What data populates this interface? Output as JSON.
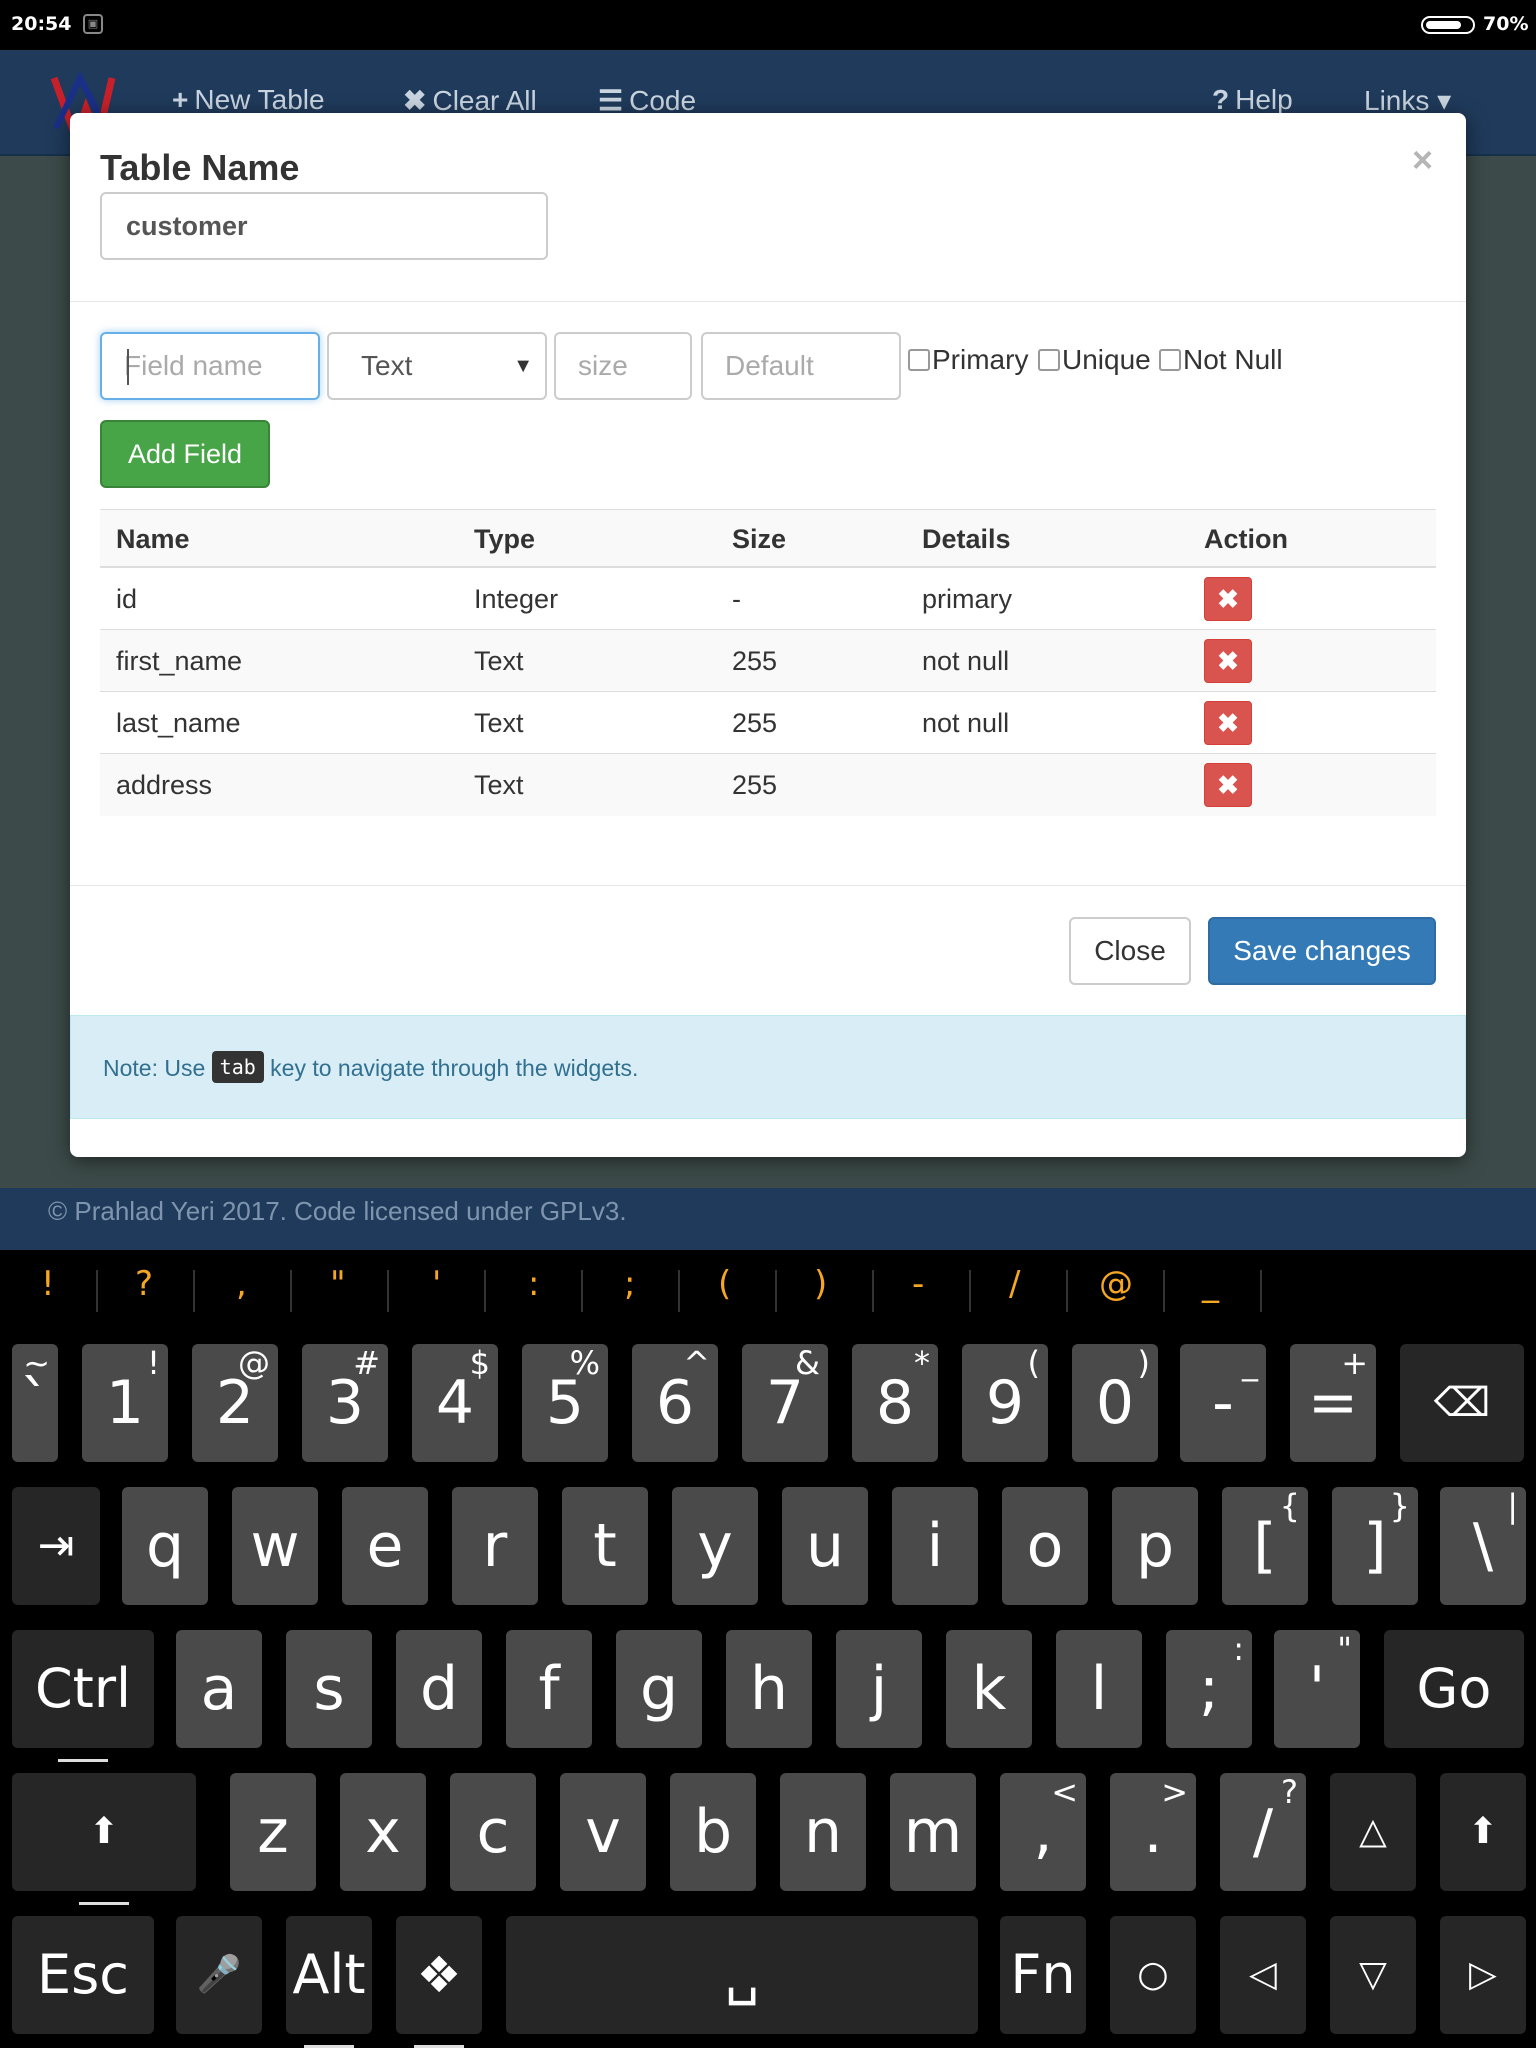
{
  "status_bar": {
    "time": "20:54",
    "battery": "70%",
    "notif_icon": "image-icon"
  },
  "navbar": {
    "items": [
      {
        "icon": "+",
        "label": "New Table"
      },
      {
        "icon": "✖",
        "label": "Clear All"
      },
      {
        "icon": "☰",
        "label": "Code"
      },
      {
        "icon": "?",
        "label": "Help"
      },
      {
        "icon": "",
        "label": "Links ▾"
      }
    ]
  },
  "footer": {
    "text": "© Prahlad Yeri 2017. Code licensed under GPLv3."
  },
  "modal": {
    "title": "Table Name",
    "close_glyph": "×",
    "table_name_value": "customer",
    "field_name_placeholder": "Field name",
    "type_value": "Text",
    "size_placeholder": "size",
    "default_placeholder": "Default",
    "checks": [
      "Primary",
      "Unique",
      "Not Null"
    ],
    "add_field_label": "Add Field",
    "table": {
      "headers": [
        "Name",
        "Type",
        "Size",
        "Details",
        "Action"
      ],
      "rows": [
        [
          "id",
          "Integer",
          "-",
          "primary"
        ],
        [
          "first_name",
          "Text",
          "255",
          "not null"
        ],
        [
          "last_name",
          "Text",
          "255",
          "not null"
        ],
        [
          "address",
          "Text",
          "255",
          ""
        ]
      ],
      "delete_glyph": "✖"
    },
    "close_label": "Close",
    "save_label": "Save changes",
    "note_prefix": "Note: Use",
    "note_code": "tab",
    "note_suffix": "key to navigate through the widgets."
  },
  "suggestions": [
    "!",
    "?",
    ",",
    "\"",
    "'",
    ":",
    ";",
    "(",
    ")",
    "-",
    "/",
    "@",
    "_"
  ],
  "keyboard": {
    "row1": [
      {
        "main": "`",
        "alt": "~"
      },
      {
        "main": "1",
        "alt": "!"
      },
      {
        "main": "2",
        "alt": "@"
      },
      {
        "main": "3",
        "alt": "#"
      },
      {
        "main": "4",
        "alt": "$"
      },
      {
        "main": "5",
        "alt": "%"
      },
      {
        "main": "6",
        "alt": "^"
      },
      {
        "main": "7",
        "alt": "&"
      },
      {
        "main": "8",
        "alt": "*"
      },
      {
        "main": "9",
        "alt": "("
      },
      {
        "main": "0",
        "alt": ")"
      },
      {
        "main": "-",
        "alt": "_"
      },
      {
        "main": "=",
        "alt": "+"
      }
    ],
    "row2": [
      {
        "main": "q"
      },
      {
        "main": "w"
      },
      {
        "main": "e"
      },
      {
        "main": "r"
      },
      {
        "main": "t"
      },
      {
        "main": "y"
      },
      {
        "main": "u"
      },
      {
        "main": "i"
      },
      {
        "main": "o"
      },
      {
        "main": "p"
      },
      {
        "main": "[",
        "alt": "{"
      },
      {
        "main": "]",
        "alt": "}"
      },
      {
        "main": "\\",
        "alt": "|"
      }
    ],
    "row3": [
      {
        "main": "a"
      },
      {
        "main": "s"
      },
      {
        "main": "d"
      },
      {
        "main": "f"
      },
      {
        "main": "g"
      },
      {
        "main": "h"
      },
      {
        "main": "j"
      },
      {
        "main": "k"
      },
      {
        "main": "l"
      },
      {
        "main": ";",
        "alt": ":"
      },
      {
        "main": "'",
        "alt": "\""
      }
    ],
    "row4": [
      {
        "main": "z"
      },
      {
        "main": "x"
      },
      {
        "main": "c"
      },
      {
        "main": "v"
      },
      {
        "main": "b"
      },
      {
        "main": "n"
      },
      {
        "main": "m"
      },
      {
        "main": ",",
        "alt": "<"
      },
      {
        "main": ".",
        "alt": ">"
      },
      {
        "main": "/",
        "alt": "?"
      }
    ],
    "ctrl": "Ctrl",
    "go": "Go",
    "esc": "Esc",
    "alt": "Alt",
    "fn": "Fn",
    "space": "␣",
    "tab_glyph": "⇥",
    "backspace_glyph": "⌫",
    "shift_glyph": "⬆",
    "up_glyph": "△",
    "mic_glyph": "🎤",
    "diamond_glyph": "❖",
    "home_glyph": "○",
    "left_glyph": "◁",
    "down_glyph": "▽",
    "right_glyph": "▷"
  }
}
